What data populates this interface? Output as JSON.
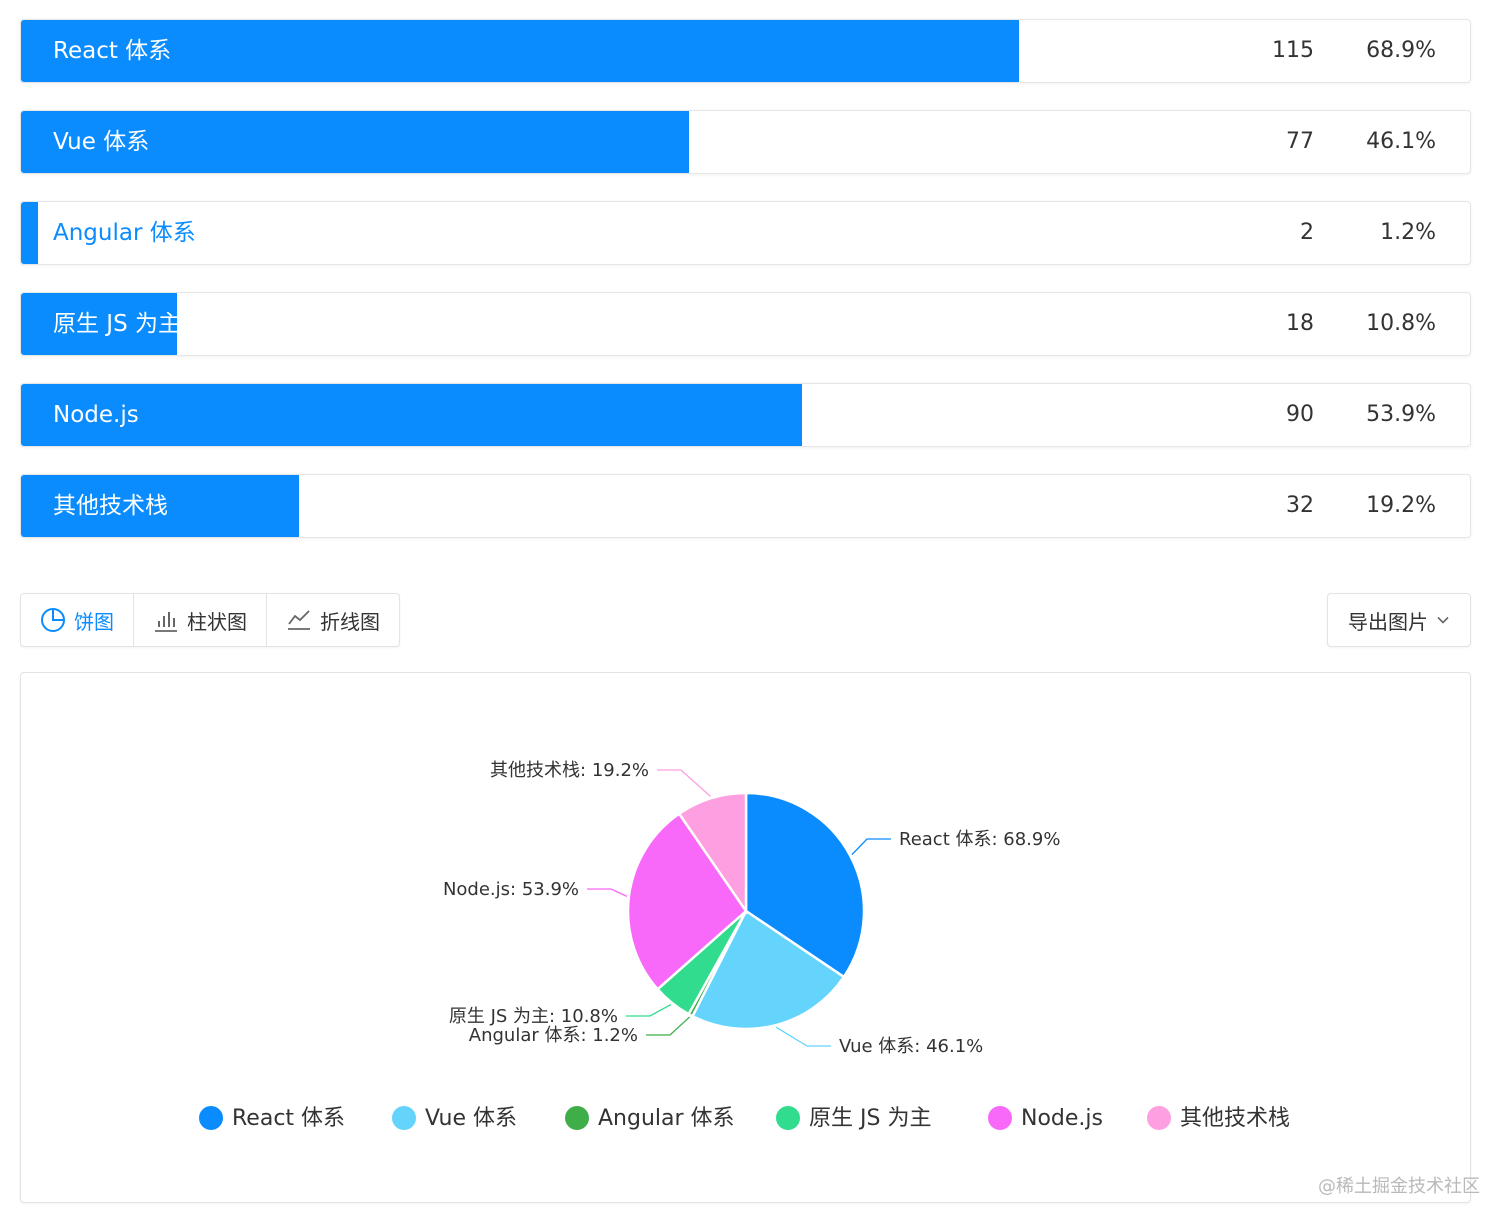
{
  "accent_color": "#0a8cff",
  "bars": [
    {
      "label": "React 体系",
      "count": "115",
      "percent": "68.9%",
      "ratio": 0.689
    },
    {
      "label": "Vue 体系",
      "count": "77",
      "percent": "46.1%",
      "ratio": 0.461
    },
    {
      "label": "Angular 体系",
      "count": "2",
      "percent": "1.2%",
      "ratio": 0.012
    },
    {
      "label": "原生 JS 为主",
      "count": "18",
      "percent": "10.8%",
      "ratio": 0.108
    },
    {
      "label": "Node.js",
      "count": "90",
      "percent": "53.9%",
      "ratio": 0.539
    },
    {
      "label": "其他技术栈",
      "count": "32",
      "percent": "19.2%",
      "ratio": 0.192
    }
  ],
  "tabs": [
    {
      "label": "饼图",
      "icon": "pie-chart-icon",
      "active": true
    },
    {
      "label": "柱状图",
      "icon": "bar-chart-icon",
      "active": false
    },
    {
      "label": "折线图",
      "icon": "line-chart-icon",
      "active": false
    }
  ],
  "export": {
    "label": "导出图片",
    "icon": "chevron-down-icon"
  },
  "chart_data": {
    "type": "pie",
    "categories": [
      "React 体系",
      "Vue 体系",
      "Angular 体系",
      "原生 JS 为主",
      "Node.js",
      "其他技术栈"
    ],
    "values": [
      115,
      77,
      2,
      18,
      90,
      32
    ],
    "slice_labels": [
      "React 体系: 68.9%",
      "Vue 体系: 46.1%",
      "Angular 体系: 1.2%",
      "原生 JS 为主: 10.8%",
      "Node.js: 53.9%",
      "其他技术栈: 19.2%"
    ],
    "colors": [
      "#0a8cff",
      "#64d4fd",
      "#3fae49",
      "#31dc8f",
      "#f868f9",
      "#fd9fe0"
    ],
    "legend_position": "bottom",
    "title": "",
    "xlabel": "",
    "ylabel": ""
  },
  "watermark": "@稀土掘金技术社区"
}
